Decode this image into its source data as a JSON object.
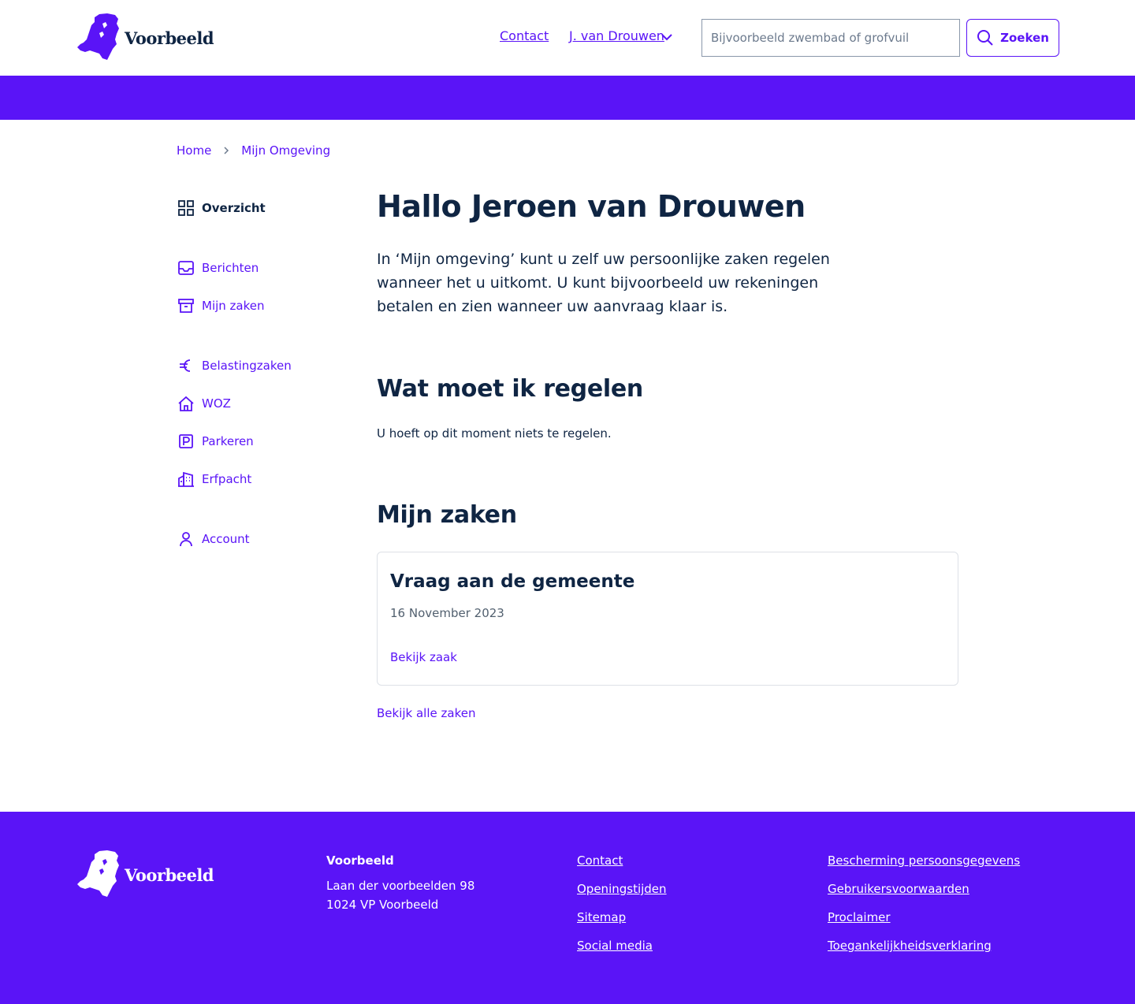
{
  "brand": {
    "name": "Voorbeeld",
    "primary_color": "#5a14f7",
    "text_color": "#0f2543"
  },
  "header": {
    "contact_label": "Contact",
    "user_label": "J. van Drouwen",
    "search_placeholder": "Bijvoorbeeld zwembad of grofvuil",
    "search_value": "",
    "search_button": "Zoeken"
  },
  "breadcrumb": {
    "items": [
      "Home",
      "Mijn Omgeving"
    ]
  },
  "sidebar": {
    "items": [
      {
        "label": "Overzicht",
        "icon": "grid-icon"
      },
      {
        "label": "Berichten",
        "icon": "inbox-icon"
      },
      {
        "label": "Mijn zaken",
        "icon": "archive-icon"
      },
      {
        "label": "Belastingzaken",
        "icon": "euro-icon"
      },
      {
        "label": "WOZ",
        "icon": "home-icon"
      },
      {
        "label": "Parkeren",
        "icon": "parking-icon"
      },
      {
        "label": "Erfpacht",
        "icon": "buildings-icon"
      },
      {
        "label": "Account",
        "icon": "user-icon"
      }
    ]
  },
  "main": {
    "greeting": "Hallo Jeroen van Drouwen",
    "intro": "In ‘Mijn omgeving’ kunt u zelf uw persoonlijke zaken regelen wanneer het u uitkomt. U kunt bijvoorbeeld uw rekeningen betalen en zien wanneer uw aanvraag klaar is.",
    "regelen_heading": "Wat moet ik regelen",
    "regelen_text": "U hoeft op dit moment niets te regelen.",
    "zaken_heading": "Mijn zaken",
    "card": {
      "title": "Vraag aan de gemeente",
      "date": "16 November 2023",
      "link": "Bekijk zaak"
    },
    "all_link": "Bekijk alle zaken"
  },
  "footer": {
    "org_name": "Voorbeeld",
    "address_line1": "Laan der voorbeelden 98",
    "address_line2": "1024 VP Voorbeeld",
    "links_col1": [
      "Contact",
      "Openingstijden",
      "Sitemap",
      "Social media"
    ],
    "links_col2": [
      "Bescherming persoonsgegevens",
      "Gebruikersvoorwaarden",
      "Proclaimer",
      "Toegankelijkheidsverklaring"
    ]
  }
}
